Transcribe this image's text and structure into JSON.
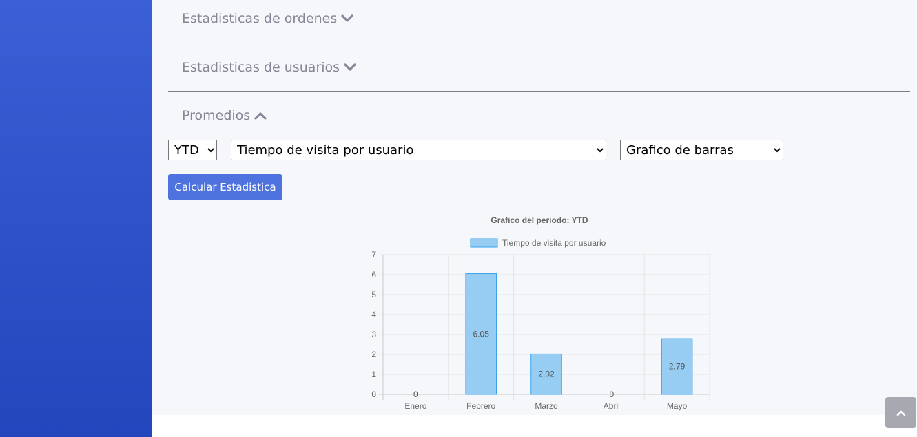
{
  "sections": [
    {
      "label": "Estadisticas de ordenes",
      "state": "collapsed",
      "icon": "chevron-down-icon"
    },
    {
      "label": "Estadisticas de usuarios",
      "state": "collapsed",
      "icon": "chevron-down-icon"
    },
    {
      "label": "Promedios",
      "state": "expanded",
      "icon": "chevron-up-icon"
    }
  ],
  "controls": {
    "period": {
      "selected": "YTD"
    },
    "metric": {
      "selected": "Tiempo de visita por usuario"
    },
    "chart_type": {
      "selected": "Grafico de barras"
    },
    "calculate_label": "Calcular Estadistica"
  },
  "colors": {
    "sidebar": "#3b5fd6",
    "accent": "#4e73df",
    "bar_fill": "#97cdf2",
    "bar_stroke": "#36a2eb",
    "text_muted": "#858796"
  },
  "chart_data": {
    "type": "bar",
    "title": "Grafico del periodo: YTD",
    "categories": [
      "Enero",
      "Febrero",
      "Marzo",
      "Abril",
      "Mayo"
    ],
    "series": [
      {
        "name": "Tiempo de visita por usuario",
        "values": [
          0,
          6.05,
          2.02,
          0,
          2.79
        ]
      }
    ],
    "data_labels": [
      "0",
      "6.05",
      "2.02",
      "0",
      "2.79"
    ],
    "ylim": [
      0,
      7
    ],
    "yticks": [
      0,
      1,
      2,
      3,
      4,
      5,
      6,
      7
    ],
    "grid": true,
    "legend": "top"
  },
  "back_to_top_icon": "chevron-up-icon"
}
